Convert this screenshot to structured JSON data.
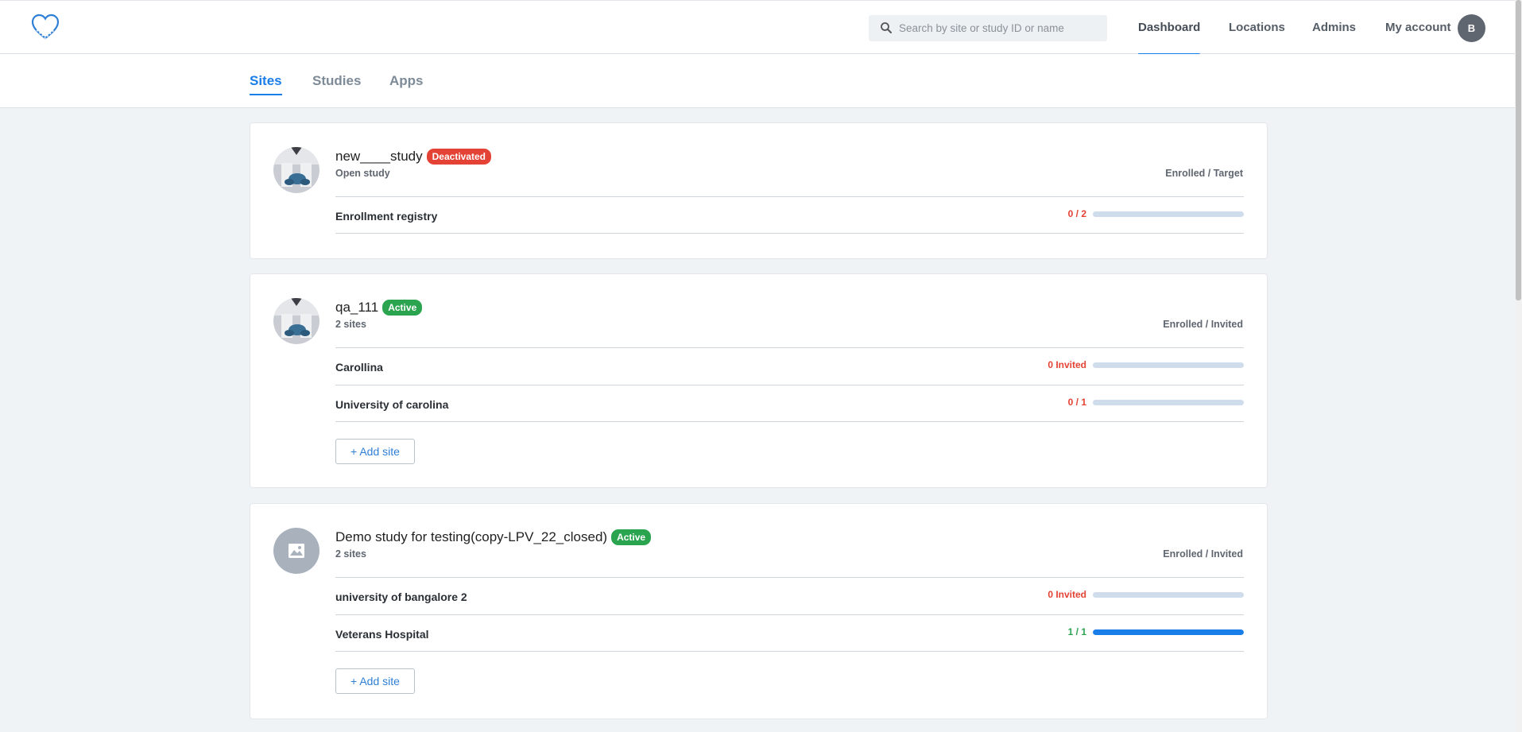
{
  "header": {
    "search": {
      "placeholder": "Search by site or study ID or name",
      "value": ""
    },
    "nav": [
      {
        "label": "Dashboard",
        "active": true
      },
      {
        "label": "Locations",
        "active": false
      },
      {
        "label": "Admins",
        "active": false
      },
      {
        "label": "My account",
        "active": false
      }
    ],
    "avatar_initial": "B"
  },
  "tabs": [
    {
      "label": "Sites",
      "active": true
    },
    {
      "label": "Studies",
      "active": false
    },
    {
      "label": "Apps",
      "active": false
    }
  ],
  "studies": [
    {
      "name": "new____study",
      "status": "Deactivated",
      "status_color": "#e34234",
      "subtitle": "Open study",
      "column_header": "Enrolled / Target",
      "image": "study-photo",
      "sites": [
        {
          "name": "Enrollment registry",
          "count": "0 / 2",
          "count_color": "#e34234",
          "progress": 0
        }
      ],
      "add_site_label": null
    },
    {
      "name": "qa_111",
      "status": "Active",
      "status_color": "#2aa44f",
      "subtitle": "2 sites",
      "column_header": "Enrolled / Invited",
      "image": "study-photo",
      "sites": [
        {
          "name": "Carollina",
          "count": "0 Invited",
          "count_color": "#e34234",
          "progress": 0
        },
        {
          "name": "University of carolina",
          "count": "0 / 1",
          "count_color": "#e34234",
          "progress": 0
        }
      ],
      "add_site_label": "+ Add site"
    },
    {
      "name": "Demo study for testing(copy-LPV_22_closed)",
      "status": "Active",
      "status_color": "#2aa44f",
      "subtitle": "2 sites",
      "column_header": "Enrolled / Invited",
      "image": "image-placeholder-icon",
      "sites": [
        {
          "name": "university of bangalore 2",
          "count": "0 Invited",
          "count_color": "#e34234",
          "progress": 0
        },
        {
          "name": "Veterans Hospital",
          "count": "1 / 1",
          "count_color": "#2aa44f",
          "progress": 1
        }
      ],
      "add_site_label": "+ Add site"
    }
  ]
}
